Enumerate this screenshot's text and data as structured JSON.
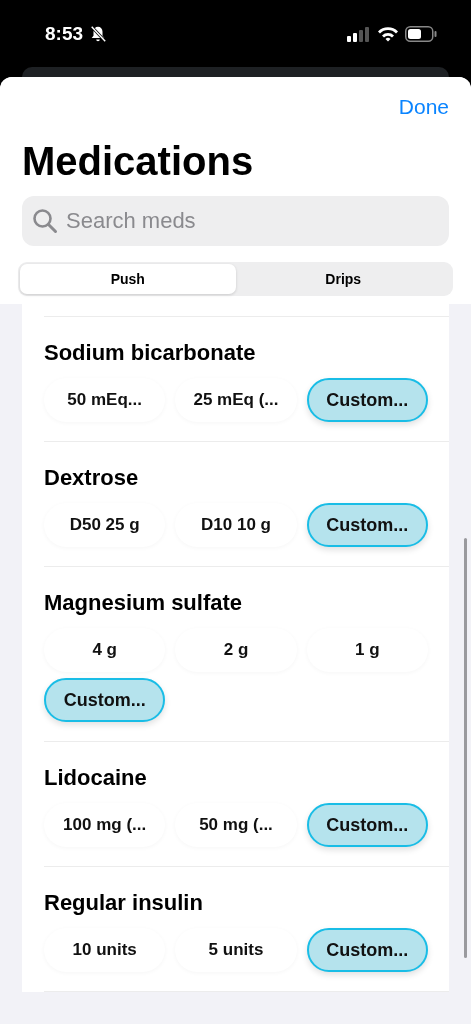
{
  "status_bar": {
    "time": "8:53"
  },
  "done_button": "Done",
  "title": "Medications",
  "search": {
    "placeholder": "Search meds"
  },
  "tabs": [
    {
      "label": "Push",
      "selected": true
    },
    {
      "label": "Drips",
      "selected": false
    }
  ],
  "medications": [
    {
      "name": "Sodium bicarbonate",
      "doses": [
        {
          "label": "50 mEq...",
          "kind": "preset"
        },
        {
          "label": "25 mEq (...",
          "kind": "preset"
        },
        {
          "label": "Custom...",
          "kind": "custom"
        }
      ]
    },
    {
      "name": "Dextrose",
      "doses": [
        {
          "label": "D50 25 g",
          "kind": "preset"
        },
        {
          "label": "D10 10 g",
          "kind": "preset"
        },
        {
          "label": "Custom...",
          "kind": "custom"
        }
      ]
    },
    {
      "name": "Magnesium sulfate",
      "doses": [
        {
          "label": "4 g",
          "kind": "preset"
        },
        {
          "label": "2 g",
          "kind": "preset"
        },
        {
          "label": "1 g",
          "kind": "preset"
        },
        {
          "label": "Custom...",
          "kind": "custom"
        }
      ]
    },
    {
      "name": "Lidocaine",
      "doses": [
        {
          "label": "100 mg (...",
          "kind": "preset"
        },
        {
          "label": "50 mg (...",
          "kind": "preset"
        },
        {
          "label": "Custom...",
          "kind": "custom"
        }
      ]
    },
    {
      "name": "Regular insulin",
      "doses": [
        {
          "label": "10 units",
          "kind": "preset"
        },
        {
          "label": "5 units",
          "kind": "preset"
        },
        {
          "label": "Custom...",
          "kind": "custom"
        }
      ]
    }
  ]
}
